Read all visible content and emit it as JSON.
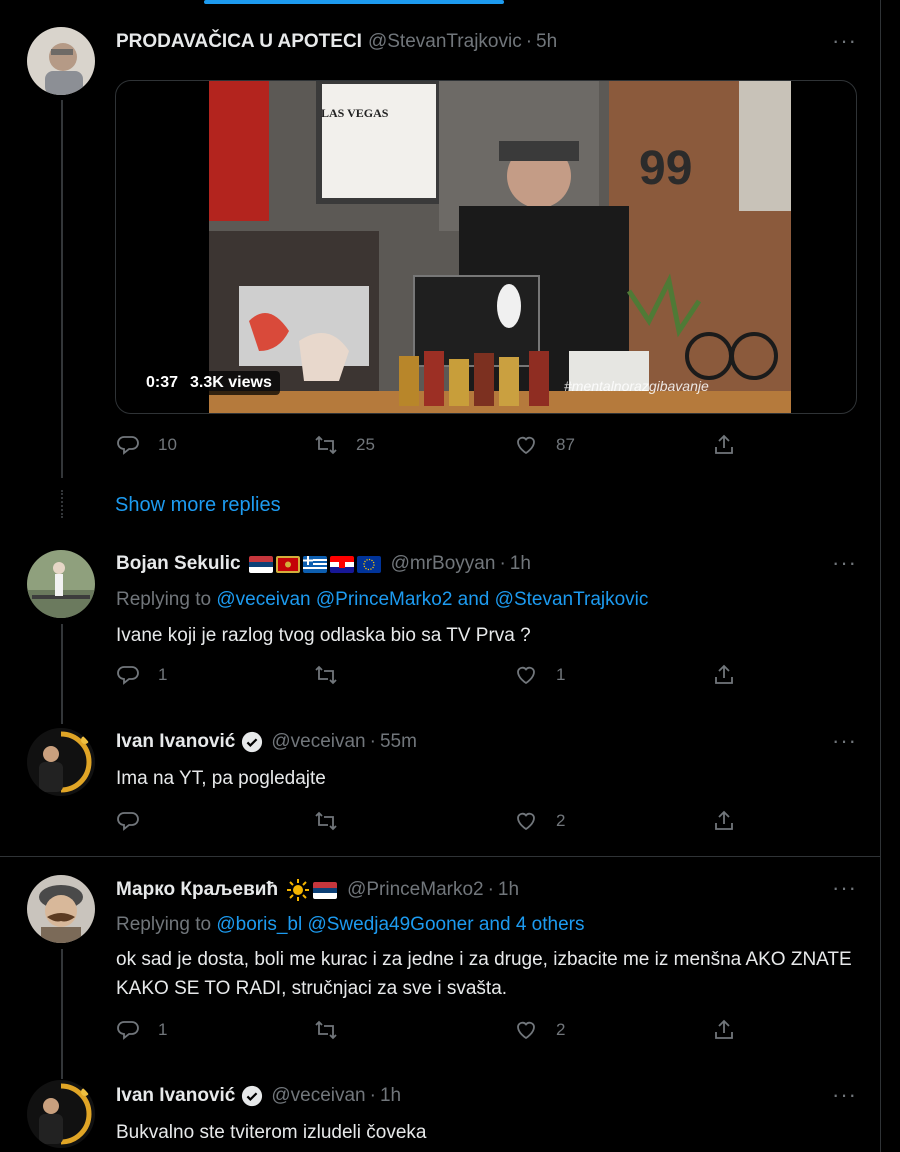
{
  "tweets": [
    {
      "name": "PRODAVAČICA U APOTECI",
      "handle": "@StevanTrajkovic",
      "time": "5h",
      "video": {
        "duration": "0:37",
        "views": "3.3K views",
        "watermark": "#mentalnorazgibavanje",
        "sign": "LAS VEGAS",
        "number": "99"
      },
      "actions": {
        "reply": "10",
        "retweet": "25",
        "like": "87"
      }
    },
    {
      "name": "Bojan Sekulic",
      "handle": "@mrBoyyan",
      "time": "1h",
      "flags": [
        "serbia",
        "montenegro",
        "greece",
        "croatia",
        "eu"
      ],
      "replying_label": "Replying to",
      "replying_links": "@veceivan @PrinceMarko2 and @StevanTrajkovic",
      "text": "Ivane koji je razlog tvog odlaska bio sa TV Prva ?",
      "actions": {
        "reply": "1",
        "retweet": "",
        "like": "1"
      }
    },
    {
      "name": "Ivan Ivanović",
      "handle": "@veceivan",
      "time": "55m",
      "text": "Ima na YT, pa pogledajte",
      "actions": {
        "reply": "",
        "retweet": "",
        "like": "2"
      }
    },
    {
      "name": "Марко Краљевић",
      "handle": "@PrinceMarko2",
      "time": "1h",
      "flags": [
        "sun",
        "serbia"
      ],
      "replying_label": "Replying to",
      "replying_links": "@boris_bl @Swedja49Gooner and 4 others",
      "text": "ok sad je dosta, boli me kurac i za jedne i za druge, izbacite me iz menšna AKO ZNATE KAKO SE TO RADI, stručnjaci za sve i svašta.",
      "actions": {
        "reply": "1",
        "retweet": "",
        "like": "2"
      }
    },
    {
      "name": "Ivan Ivanović",
      "handle": "@veceivan",
      "time": "1h",
      "text": "Bukvalno ste tviterom izludeli čoveka"
    }
  ],
  "show_more": "Show more replies",
  "more_glyph": "···",
  "dot": "·",
  "colors": {
    "accent": "#1d9bf0",
    "muted": "#71767b",
    "text": "#e7e9ea",
    "border": "#2f3336"
  }
}
